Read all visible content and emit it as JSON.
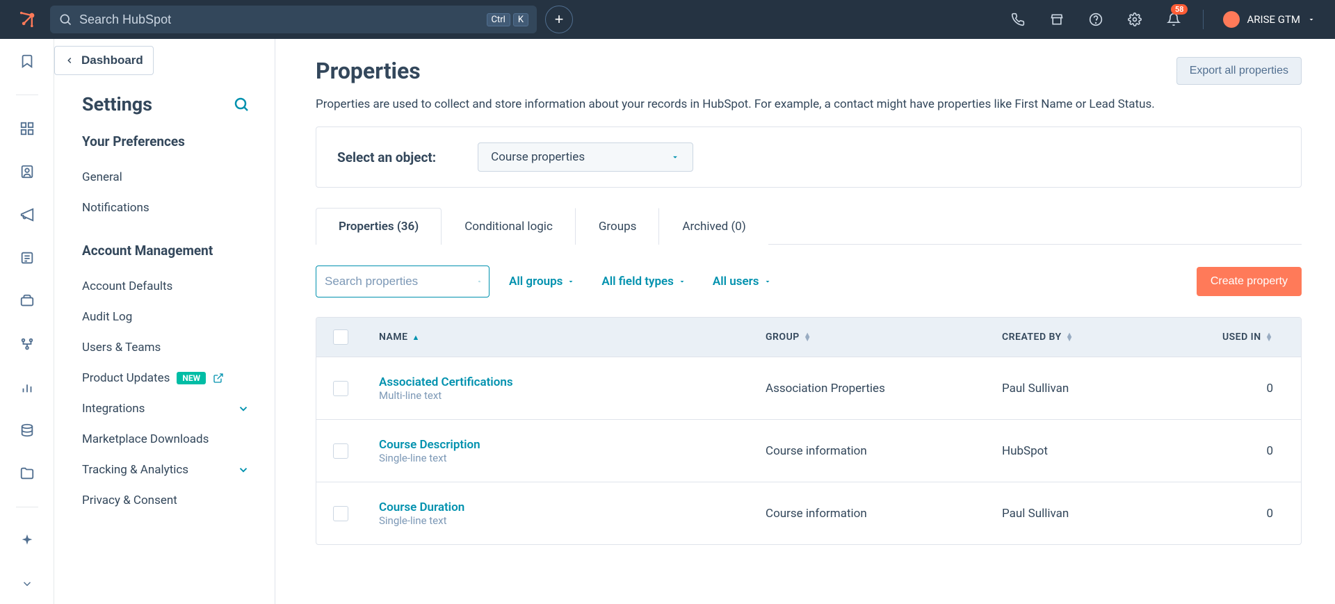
{
  "topnav": {
    "search_placeholder": "Search HubSpot",
    "kbd1": "Ctrl",
    "kbd2": "K",
    "notif_count": "58",
    "account_name": "ARISE GTM"
  },
  "sidebar": {
    "dashboard": "Dashboard",
    "settings_title": "Settings",
    "pref_heading": "Your Preferences",
    "general": "General",
    "notifications": "Notifications",
    "account_heading": "Account Management",
    "account_defaults": "Account Defaults",
    "audit_log": "Audit Log",
    "users_teams": "Users & Teams",
    "product_updates": "Product Updates",
    "new_badge": "NEW",
    "integrations": "Integrations",
    "marketplace": "Marketplace Downloads",
    "tracking": "Tracking & Analytics",
    "privacy": "Privacy & Consent"
  },
  "main": {
    "title": "Properties",
    "export_btn": "Export all properties",
    "description": "Properties are used to collect and store information about your records in HubSpot. For example, a contact might have properties like First Name or Lead Status.",
    "select_label": "Select an object:",
    "select_value": "Course properties",
    "tabs": {
      "properties": "Properties (36)",
      "conditional": "Conditional logic",
      "groups": "Groups",
      "archived": "Archived (0)"
    },
    "search_placeholder": "Search properties",
    "filter_groups": "All groups",
    "filter_types": "All field types",
    "filter_users": "All users",
    "create_btn": "Create property",
    "columns": {
      "name": "NAME",
      "group": "GROUP",
      "created": "CREATED BY",
      "used": "USED IN"
    },
    "rows": [
      {
        "name": "Associated Certifications",
        "type": "Multi-line text",
        "group": "Association Properties",
        "created": "Paul Sullivan",
        "used": "0"
      },
      {
        "name": "Course Description",
        "type": "Single-line text",
        "group": "Course information",
        "created": "HubSpot",
        "used": "0"
      },
      {
        "name": "Course Duration",
        "type": "Single-line text",
        "group": "Course information",
        "created": "Paul Sullivan",
        "used": "0"
      }
    ]
  }
}
